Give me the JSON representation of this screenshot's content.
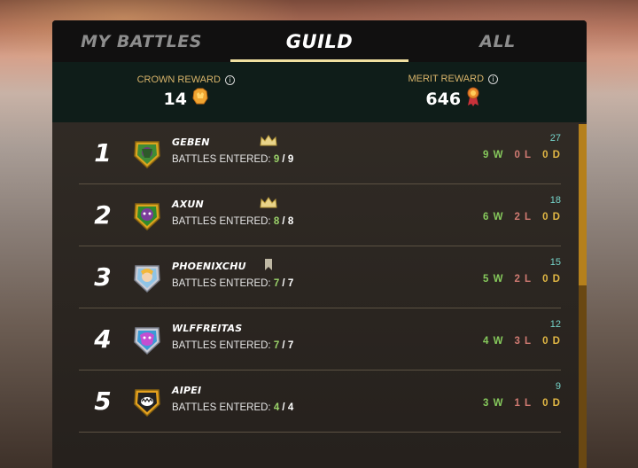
{
  "tabs": [
    {
      "label": "MY BATTLES",
      "active": false
    },
    {
      "label": "GUILD",
      "active": true
    },
    {
      "label": "ALL",
      "active": false
    }
  ],
  "rewards": {
    "crown": {
      "label": "CROWN REWARD",
      "value": "14",
      "icon": "crown-token-icon"
    },
    "merit": {
      "label": "MERIT REWARD",
      "value": "646",
      "icon": "merit-medal-icon"
    }
  },
  "battles_label": "BATTLES ENTERED:",
  "players": [
    {
      "rank": "1",
      "name": "GEBEN",
      "entered": "9",
      "total": "9",
      "score": "27",
      "wins": "9 W",
      "losses": "0 L",
      "draws": "0 D",
      "badge": "crown-icon",
      "avatar": "earth-guild-avatar"
    },
    {
      "rank": "2",
      "name": "AXUN",
      "entered": "8",
      "total": "8",
      "score": "18",
      "wins": "6 W",
      "losses": "2 L",
      "draws": "0 D",
      "badge": "crown-icon",
      "avatar": "death-guild-avatar"
    },
    {
      "rank": "3",
      "name": "PHOENIXCHU",
      "entered": "7",
      "total": "7",
      "score": "15",
      "wins": "5 W",
      "losses": "2 L",
      "draws": "0 D",
      "badge": "bookmark-icon",
      "avatar": "life-guild-avatar"
    },
    {
      "rank": "4",
      "name": "WLFFREITAS",
      "entered": "7",
      "total": "7",
      "score": "12",
      "wins": "4 W",
      "losses": "3 L",
      "draws": "0 D",
      "badge": "",
      "avatar": "water-guild-avatar"
    },
    {
      "rank": "5",
      "name": "AIPEI",
      "entered": "4",
      "total": "4",
      "score": "9",
      "wins": "3 W",
      "losses": "1 L",
      "draws": "0 D",
      "badge": "",
      "avatar": "monster-guild-avatar"
    }
  ],
  "colors": {
    "accent_gold": "#f0dfa0",
    "win": "#86c95c",
    "loss": "#d07a72",
    "draw": "#e1b744",
    "score": "#75d3c9"
  }
}
